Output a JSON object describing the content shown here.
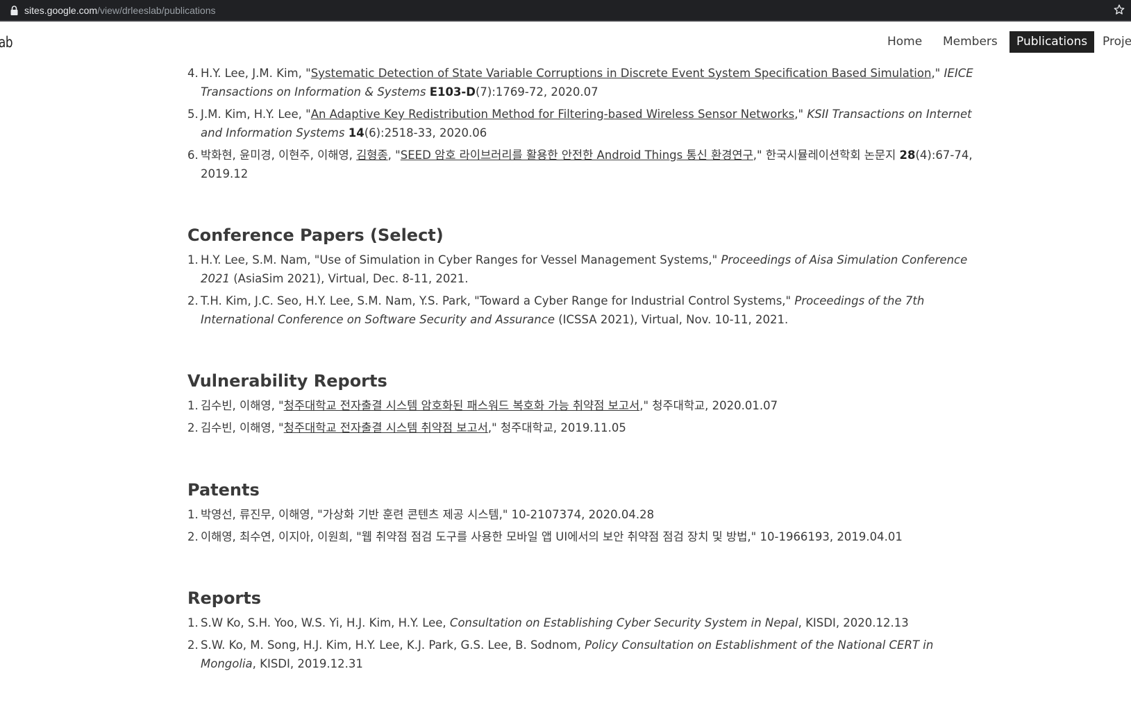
{
  "browser": {
    "url_host": "sites.google.com",
    "url_path": "/view/drleeslab/publications"
  },
  "site": {
    "name": "ab",
    "nav": [
      {
        "label": "Home"
      },
      {
        "label": "Members"
      },
      {
        "label": "Publications",
        "active": true
      },
      {
        "label": "Projec"
      }
    ]
  },
  "journals_tail": [
    {
      "num": "4.",
      "authors": "H.Y. Lee, J.M. Kim, \"",
      "link": "Systematic Detection of State Variable Corruptions in Discrete Event System Specification Based Simulation",
      "after": ",\" ",
      "venue": "IEICE Transactions on Information & Systems",
      "sep": " ",
      "vol": "E103-D",
      "rest": "(7):1769-72, 2020.07"
    },
    {
      "num": "5.",
      "authors": "J.M. Kim, H.Y. Lee, \"",
      "link": "An Adaptive Key Redistribution Method for Filtering-based Wireless Sensor Networks",
      "after": ",\" ",
      "venue": "KSII Transactions on Internet and Information Systems",
      "sep": " ",
      "vol": "14",
      "rest": "(6):2518-33, 2020.06"
    },
    {
      "num": "6.",
      "authors": "박화현, 윤미경, 이현주, 이해영, ",
      "author_link": "김형종",
      "mid": ", \"",
      "link": "SEED 암호 라이브러리를 활용한 안전한 Android Things 통신 환경연구",
      "after": ",\" 한국시뮬레이션학회 논문지 ",
      "vol": "28",
      "rest": "(4):67-74, 2019.12"
    }
  ],
  "conference": {
    "title": "Conference Papers (Select)",
    "items": [
      {
        "num": "1.",
        "text": "H.Y. Lee, S.M. Nam, \"Use of Simulation in Cyber Ranges for Vessel Management Systems,\" ",
        "venue": "Proceedings of Aisa Simulation Conference 2021",
        "rest": " (AsiaSim 2021), Virtual, Dec. 8-11, 2021."
      },
      {
        "num": "2.",
        "text": "T.H. Kim, J.C. Seo, H.Y. Lee, S.M. Nam, Y.S. Park, \"Toward a Cyber Range for Industrial Control Systems,\" ",
        "venue": "Proceedings of the 7th International Conference on Software Security and Assurance",
        "rest": " (ICSSA 2021), Virtual, Nov. 10-11, 2021."
      }
    ]
  },
  "vulnerability": {
    "title": "Vulnerability Reports",
    "items": [
      {
        "num": "1.",
        "pre": "김수빈, 이해영, \"",
        "link": "청주대학교 전자출결 시스템 암호화된 패스워드 복호화 가능 취약점 보고서",
        "rest": ",\" 청주대학교, 2020.01.07"
      },
      {
        "num": "2.",
        "pre": "김수빈, 이해영, \"",
        "link": "청주대학교 전자출결 시스템 취약점 보고서",
        "rest": ",\" 청주대학교, 2019.11.05"
      }
    ]
  },
  "patents": {
    "title": "Patents",
    "items": [
      {
        "num": "1.",
        "text": "박영선, 류진무, 이해영, \"가상화 기반 훈련 콘텐츠 제공 시스템,\" 10-2107374, 2020.04.28"
      },
      {
        "num": "2.",
        "text": "이해영, 최수연, 이지아, 이원희, \"웹 취약점 점검 도구를 사용한 모바일 앱 UI에서의 보안 취약점 점검 장치 및 방법,\" 10-1966193, 2019.04.01"
      }
    ]
  },
  "reports": {
    "title": "Reports",
    "items": [
      {
        "num": "1.",
        "text": "S.W Ko, S.H. Yoo, W.S. Yi, H.J. Kim, H.Y. Lee, ",
        "venue": "Consultation on Establishing Cyber Security System in Nepal",
        "rest": ", KISDI, 2020.12.13"
      },
      {
        "num": "2.",
        "text": "S.W. Ko, M. Song, H.J. Kim, H.Y. Lee, K.J. Park, G.S. Lee, B. Sodnom, ",
        "venue": "Policy Consultation on Establishment of the National CERT in Mongolia",
        "rest": ", KISDI, 2019.12.31"
      }
    ]
  }
}
